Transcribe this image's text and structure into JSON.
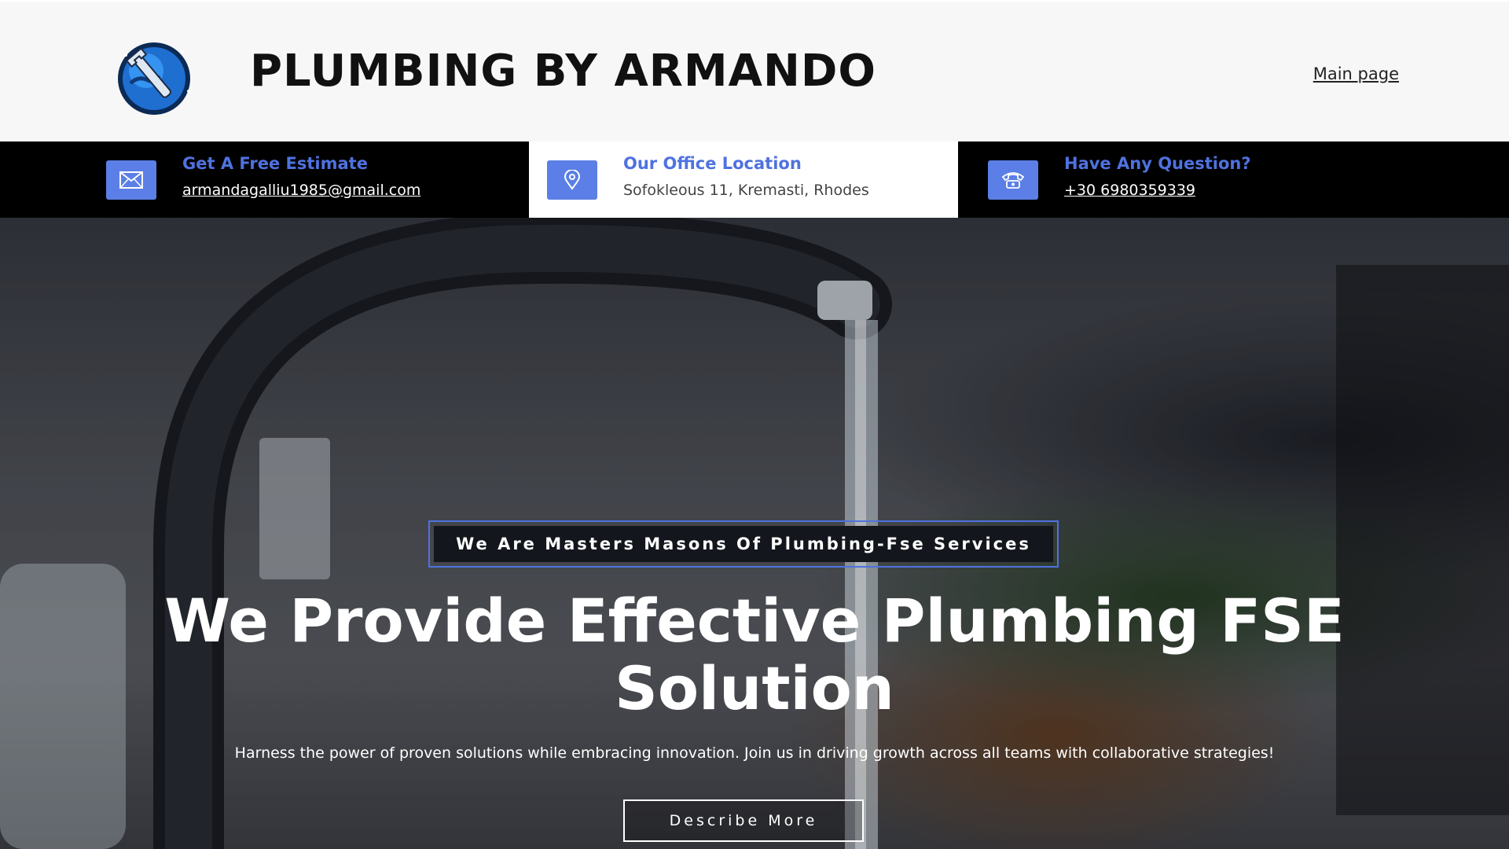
{
  "header": {
    "brand": "PLUMBING BY ARMANDO",
    "main_link": "Main page"
  },
  "infobar": {
    "estimate": {
      "title": "Get A Free Estimate",
      "value": "armandagalliu1985@gmail.com",
      "icon": "envelope-icon"
    },
    "location": {
      "title": "Our Office Location",
      "value": "Sofokleous 11, Kremasti, Rhodes",
      "icon": "location-pin-icon"
    },
    "question": {
      "title": "Have Any Question?",
      "value": "+30 6980359339",
      "icon": "phone-icon"
    }
  },
  "hero": {
    "badge": "We Are Masters Masons Of Plumbing-Fse Services",
    "title": "We Provide Effective Plumbing FSE Solution",
    "subtitle": "Harness the power of proven solutions while embracing innovation. Join us in driving growth across all teams with collaborative strategies!",
    "button": "Describe More"
  },
  "colors": {
    "accent": "#4f72e0",
    "icon_bg": "#5b7fe6",
    "header_bg": "#f7f7f7",
    "infobar_bg": "#000000"
  }
}
